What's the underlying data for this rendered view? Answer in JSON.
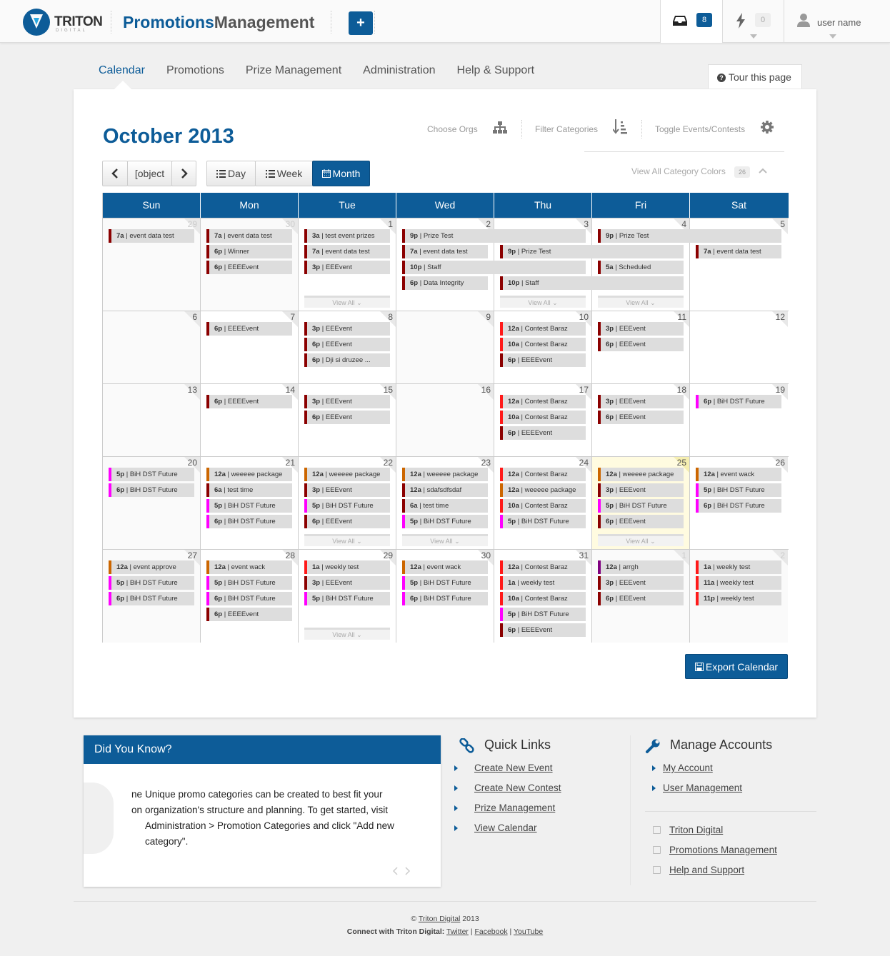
{
  "header": {
    "logo_text": "TRITON",
    "logo_sub": "DIGITAL",
    "app_title_a": "Promotions",
    "app_title_b": "Management",
    "add_label": "+",
    "inbox_count": "8",
    "alerts_count": "0",
    "user_name": "user name"
  },
  "nav": {
    "items": [
      "Calendar",
      "Promotions",
      "Prize Management",
      "Administration",
      "Help & Support"
    ],
    "active": "Calendar",
    "tour": "Tour this page"
  },
  "calendar": {
    "title": "October 2013",
    "choose_orgs": "Choose Orgs",
    "filter_categories": "Filter Categories",
    "toggle": "Toggle Events/Contests",
    "today": {
      "w": 3,
      "d": 5
    },
    "day": "Day",
    "week": "Week",
    "month": "Month",
    "view_all_colors": "View All Category Colors",
    "colors_count": "26",
    "view_all": "View All",
    "days": [
      "Sun",
      "Mon",
      "Tue",
      "Wed",
      "Thu",
      "Fri",
      "Sat"
    ],
    "weeks": [
      {
        "dates": [
          "29",
          "30",
          "1",
          "2",
          "3",
          "4",
          "5"
        ],
        "other": [
          true,
          true,
          false,
          false,
          false,
          false,
          false
        ]
      },
      {
        "dates": [
          "6",
          "7",
          "8",
          "9",
          "10",
          "11",
          "12"
        ],
        "other": [
          false,
          false,
          false,
          false,
          false,
          false,
          false
        ]
      },
      {
        "dates": [
          "13",
          "14",
          "15",
          "16",
          "17",
          "18",
          "19"
        ],
        "other": [
          false,
          false,
          false,
          false,
          false,
          false,
          false
        ]
      },
      {
        "dates": [
          "20",
          "21",
          "22",
          "23",
          "24",
          "25",
          "26"
        ],
        "other": [
          false,
          false,
          false,
          false,
          false,
          false,
          false
        ]
      },
      {
        "dates": [
          "27",
          "28",
          "29",
          "30",
          "31",
          "1",
          "2"
        ],
        "other": [
          false,
          false,
          false,
          false,
          false,
          true,
          true
        ]
      }
    ],
    "events": [
      {
        "w": 0,
        "d": 0,
        "s": 0,
        "span": 1,
        "t": "7a",
        "n": "event data test",
        "c": "#8b0000"
      },
      {
        "w": 0,
        "d": 1,
        "s": 0,
        "span": 1,
        "t": "7a",
        "n": "event data test",
        "c": "#8b0000"
      },
      {
        "w": 0,
        "d": 1,
        "s": 1,
        "span": 1,
        "t": "6p",
        "n": "Winner",
        "c": "#8b0000"
      },
      {
        "w": 0,
        "d": 1,
        "s": 2,
        "span": 1,
        "t": "6p",
        "n": "EEEEvent",
        "c": "#8b0000"
      },
      {
        "w": 0,
        "d": 2,
        "s": 0,
        "span": 1,
        "t": "3a",
        "n": "test event prizes",
        "c": "#8b0000"
      },
      {
        "w": 0,
        "d": 2,
        "s": 1,
        "span": 1,
        "t": "7a",
        "n": "event data test",
        "c": "#8b0000"
      },
      {
        "w": 0,
        "d": 2,
        "s": 2,
        "span": 1,
        "t": "3p",
        "n": "EEEvent",
        "c": "#8b0000"
      },
      {
        "w": 0,
        "d": 3,
        "s": 0,
        "span": 2,
        "t": "9p",
        "n": "Prize Test",
        "c": "#8b0000"
      },
      {
        "w": 0,
        "d": 3,
        "s": 1,
        "span": 1,
        "t": "7a",
        "n": "event data test",
        "c": "#8b0000"
      },
      {
        "w": 0,
        "d": 3,
        "s": 2,
        "span": 2,
        "t": "10p",
        "n": "Staff",
        "c": "#8b0000"
      },
      {
        "w": 0,
        "d": 3,
        "s": 3,
        "span": 1,
        "t": "6p",
        "n": "Data Integrity",
        "c": "#8b0000"
      },
      {
        "w": 0,
        "d": 4,
        "s": 1,
        "span": 2,
        "t": "9p",
        "n": "Prize Test",
        "c": "#8b0000"
      },
      {
        "w": 0,
        "d": 4,
        "s": 3,
        "span": 2,
        "t": "10p",
        "n": "Staff",
        "c": "#8b0000"
      },
      {
        "w": 0,
        "d": 5,
        "s": 0,
        "span": 2,
        "t": "9p",
        "n": "Prize Test",
        "c": "#8b0000"
      },
      {
        "w": 0,
        "d": 5,
        "s": 2,
        "span": 1,
        "t": "5a",
        "n": "Scheduled",
        "c": "#8b0000"
      },
      {
        "w": 0,
        "d": 6,
        "s": 1,
        "span": 1,
        "t": "7a",
        "n": "event data test",
        "c": "#8b0000"
      },
      {
        "w": 1,
        "d": 1,
        "s": 0,
        "span": 1,
        "t": "6p",
        "n": "EEEEvent",
        "c": "#8b0000"
      },
      {
        "w": 1,
        "d": 2,
        "s": 0,
        "span": 1,
        "t": "3p",
        "n": "EEEvent",
        "c": "#8b0000"
      },
      {
        "w": 1,
        "d": 2,
        "s": 1,
        "span": 1,
        "t": "6p",
        "n": "EEEvent",
        "c": "#8b0000"
      },
      {
        "w": 1,
        "d": 2,
        "s": 2,
        "span": 1,
        "t": "6p",
        "n": "Dji si druzee ...",
        "c": "#8b0000"
      },
      {
        "w": 1,
        "d": 4,
        "s": 0,
        "span": 1,
        "t": "12a",
        "n": "Contest Baraz",
        "c": "#ff1a1a"
      },
      {
        "w": 1,
        "d": 4,
        "s": 1,
        "span": 1,
        "t": "10a",
        "n": "Contest Baraz",
        "c": "#ff1a1a"
      },
      {
        "w": 1,
        "d": 4,
        "s": 2,
        "span": 1,
        "t": "6p",
        "n": "EEEEvent",
        "c": "#8b0000"
      },
      {
        "w": 1,
        "d": 5,
        "s": 0,
        "span": 1,
        "t": "3p",
        "n": "EEEvent",
        "c": "#8b0000"
      },
      {
        "w": 1,
        "d": 5,
        "s": 1,
        "span": 1,
        "t": "6p",
        "n": "EEEvent",
        "c": "#8b0000"
      },
      {
        "w": 2,
        "d": 1,
        "s": 0,
        "span": 1,
        "t": "6p",
        "n": "EEEEvent",
        "c": "#8b0000"
      },
      {
        "w": 2,
        "d": 2,
        "s": 0,
        "span": 1,
        "t": "3p",
        "n": "EEEvent",
        "c": "#8b0000"
      },
      {
        "w": 2,
        "d": 2,
        "s": 1,
        "span": 1,
        "t": "6p",
        "n": "EEEvent",
        "c": "#8b0000"
      },
      {
        "w": 2,
        "d": 4,
        "s": 0,
        "span": 1,
        "t": "12a",
        "n": "Contest Baraz",
        "c": "#ff1a1a"
      },
      {
        "w": 2,
        "d": 4,
        "s": 1,
        "span": 1,
        "t": "10a",
        "n": "Contest Baraz",
        "c": "#ff1a1a"
      },
      {
        "w": 2,
        "d": 4,
        "s": 2,
        "span": 1,
        "t": "6p",
        "n": "EEEEvent",
        "c": "#8b0000"
      },
      {
        "w": 2,
        "d": 5,
        "s": 0,
        "span": 1,
        "t": "3p",
        "n": "EEEvent",
        "c": "#8b0000"
      },
      {
        "w": 2,
        "d": 5,
        "s": 1,
        "span": 1,
        "t": "6p",
        "n": "EEEvent",
        "c": "#8b0000"
      },
      {
        "w": 2,
        "d": 6,
        "s": 0,
        "span": 1,
        "t": "6p",
        "n": "BiH DST Future",
        "c": "#ff00ff"
      },
      {
        "w": 3,
        "d": 0,
        "s": 0,
        "span": 1,
        "t": "5p",
        "n": "BiH DST Future",
        "c": "#ff00ff"
      },
      {
        "w": 3,
        "d": 0,
        "s": 1,
        "span": 1,
        "t": "6p",
        "n": "BiH DST Future",
        "c": "#ff00ff"
      },
      {
        "w": 3,
        "d": 1,
        "s": 0,
        "span": 1,
        "t": "12a",
        "n": "weeeee package",
        "c": "#cc6600"
      },
      {
        "w": 3,
        "d": 1,
        "s": 1,
        "span": 1,
        "t": "6a",
        "n": "test time",
        "c": "#8b0000"
      },
      {
        "w": 3,
        "d": 1,
        "s": 2,
        "span": 1,
        "t": "5p",
        "n": "BiH DST Future",
        "c": "#ff00ff"
      },
      {
        "w": 3,
        "d": 1,
        "s": 3,
        "span": 1,
        "t": "6p",
        "n": "BiH DST Future",
        "c": "#ff00ff"
      },
      {
        "w": 3,
        "d": 2,
        "s": 0,
        "span": 1,
        "t": "12a",
        "n": "weeeee package",
        "c": "#cc6600"
      },
      {
        "w": 3,
        "d": 2,
        "s": 1,
        "span": 1,
        "t": "3p",
        "n": "EEEvent",
        "c": "#8b0000"
      },
      {
        "w": 3,
        "d": 2,
        "s": 2,
        "span": 1,
        "t": "5p",
        "n": "BiH DST Future",
        "c": "#ff00ff"
      },
      {
        "w": 3,
        "d": 2,
        "s": 3,
        "span": 1,
        "t": "6p",
        "n": "EEEvent",
        "c": "#8b0000"
      },
      {
        "w": 3,
        "d": 3,
        "s": 0,
        "span": 1,
        "t": "12a",
        "n": "weeeee package",
        "c": "#cc6600"
      },
      {
        "w": 3,
        "d": 3,
        "s": 1,
        "span": 1,
        "t": "12a",
        "n": "sdafsdfsdaf",
        "c": "#8b0000"
      },
      {
        "w": 3,
        "d": 3,
        "s": 2,
        "span": 1,
        "t": "6a",
        "n": "test time",
        "c": "#8b0000"
      },
      {
        "w": 3,
        "d": 3,
        "s": 3,
        "span": 1,
        "t": "5p",
        "n": "BiH DST Future",
        "c": "#ff00ff"
      },
      {
        "w": 3,
        "d": 4,
        "s": 0,
        "span": 1,
        "t": "12a",
        "n": "Contest Baraz",
        "c": "#ff1a1a"
      },
      {
        "w": 3,
        "d": 4,
        "s": 1,
        "span": 1,
        "t": "12a",
        "n": "weeeee package",
        "c": "#cc6600"
      },
      {
        "w": 3,
        "d": 4,
        "s": 2,
        "span": 1,
        "t": "10a",
        "n": "Contest Baraz",
        "c": "#ff1a1a"
      },
      {
        "w": 3,
        "d": 4,
        "s": 3,
        "span": 1,
        "t": "5p",
        "n": "BiH DST Future",
        "c": "#ff00ff"
      },
      {
        "w": 3,
        "d": 5,
        "s": 0,
        "span": 1,
        "t": "12a",
        "n": "weeeee package",
        "c": "#cc6600"
      },
      {
        "w": 3,
        "d": 5,
        "s": 1,
        "span": 1,
        "t": "3p",
        "n": "EEEvent",
        "c": "#8b0000"
      },
      {
        "w": 3,
        "d": 5,
        "s": 2,
        "span": 1,
        "t": "5p",
        "n": "BiH DST Future",
        "c": "#ff00ff"
      },
      {
        "w": 3,
        "d": 5,
        "s": 3,
        "span": 1,
        "t": "6p",
        "n": "EEEvent",
        "c": "#8b0000"
      },
      {
        "w": 3,
        "d": 6,
        "s": 0,
        "span": 1,
        "t": "12a",
        "n": "event wack",
        "c": "#cc6600"
      },
      {
        "w": 3,
        "d": 6,
        "s": 1,
        "span": 1,
        "t": "5p",
        "n": "BiH DST Future",
        "c": "#ff00ff"
      },
      {
        "w": 3,
        "d": 6,
        "s": 2,
        "span": 1,
        "t": "6p",
        "n": "BiH DST Future",
        "c": "#ff00ff"
      },
      {
        "w": 4,
        "d": 0,
        "s": 0,
        "span": 1,
        "t": "12a",
        "n": "event approve",
        "c": "#cc6600"
      },
      {
        "w": 4,
        "d": 0,
        "s": 1,
        "span": 1,
        "t": "5p",
        "n": "BiH DST Future",
        "c": "#ff00ff"
      },
      {
        "w": 4,
        "d": 0,
        "s": 2,
        "span": 1,
        "t": "6p",
        "n": "BiH DST Future",
        "c": "#ff00ff"
      },
      {
        "w": 4,
        "d": 1,
        "s": 0,
        "span": 1,
        "t": "12a",
        "n": "event wack",
        "c": "#cc6600"
      },
      {
        "w": 4,
        "d": 1,
        "s": 1,
        "span": 1,
        "t": "5p",
        "n": "BiH DST Future",
        "c": "#ff00ff"
      },
      {
        "w": 4,
        "d": 1,
        "s": 2,
        "span": 1,
        "t": "6p",
        "n": "BiH DST Future",
        "c": "#ff00ff"
      },
      {
        "w": 4,
        "d": 1,
        "s": 3,
        "span": 1,
        "t": "6p",
        "n": "EEEEvent",
        "c": "#8b0000"
      },
      {
        "w": 4,
        "d": 2,
        "s": 0,
        "span": 1,
        "t": "1a",
        "n": "weekly test",
        "c": "#ff1a1a"
      },
      {
        "w": 4,
        "d": 2,
        "s": 1,
        "span": 1,
        "t": "3p",
        "n": "EEEvent",
        "c": "#8b0000"
      },
      {
        "w": 4,
        "d": 2,
        "s": 2,
        "span": 1,
        "t": "5p",
        "n": "BiH DST Future",
        "c": "#ff00ff"
      },
      {
        "w": 4,
        "d": 3,
        "s": 0,
        "span": 1,
        "t": "12a",
        "n": "event wack",
        "c": "#cc6600"
      },
      {
        "w": 4,
        "d": 3,
        "s": 1,
        "span": 1,
        "t": "5p",
        "n": "BiH DST Future",
        "c": "#ff00ff"
      },
      {
        "w": 4,
        "d": 3,
        "s": 2,
        "span": 1,
        "t": "6p",
        "n": "BiH DST Future",
        "c": "#ff00ff"
      },
      {
        "w": 4,
        "d": 4,
        "s": 0,
        "span": 1,
        "t": "12a",
        "n": "Contest Baraz",
        "c": "#ff1a1a"
      },
      {
        "w": 4,
        "d": 4,
        "s": 1,
        "span": 1,
        "t": "1a",
        "n": "weekly test",
        "c": "#ff1a1a"
      },
      {
        "w": 4,
        "d": 4,
        "s": 2,
        "span": 1,
        "t": "10a",
        "n": "Contest Baraz",
        "c": "#ff1a1a"
      },
      {
        "w": 4,
        "d": 4,
        "s": 3,
        "span": 1,
        "t": "5p",
        "n": "BiH DST Future",
        "c": "#ff00ff"
      },
      {
        "w": 4,
        "d": 4,
        "s": 4,
        "span": 1,
        "t": "6p",
        "n": "EEEEvent",
        "c": "#8b0000"
      },
      {
        "w": 4,
        "d": 5,
        "s": 0,
        "span": 1,
        "t": "12a",
        "n": "arrgh",
        "c": "#800080"
      },
      {
        "w": 4,
        "d": 5,
        "s": 1,
        "span": 1,
        "t": "3p",
        "n": "EEEvent",
        "c": "#8b0000"
      },
      {
        "w": 4,
        "d": 5,
        "s": 2,
        "span": 1,
        "t": "6p",
        "n": "EEEvent",
        "c": "#8b0000"
      },
      {
        "w": 4,
        "d": 6,
        "s": 0,
        "span": 1,
        "t": "1a",
        "n": "weekly test",
        "c": "#ff1a1a"
      },
      {
        "w": 4,
        "d": 6,
        "s": 1,
        "span": 1,
        "t": "11a",
        "n": "weekly test",
        "c": "#ff1a1a"
      },
      {
        "w": 4,
        "d": 6,
        "s": 2,
        "span": 1,
        "t": "11p",
        "n": "weekly test",
        "c": "#ff1a1a"
      }
    ],
    "view_all_links": [
      {
        "w": 0,
        "d": 2
      },
      {
        "w": 0,
        "d": 4
      },
      {
        "w": 0,
        "d": 5
      },
      {
        "w": 3,
        "d": 2
      },
      {
        "w": 3,
        "d": 3
      },
      {
        "w": 3,
        "d": 5
      },
      {
        "w": 4,
        "d": 2
      }
    ],
    "export": "Export Calendar"
  },
  "did_you_know": {
    "title": "Did You Know?",
    "cut_text": "ne on",
    "text": "Unique promo categories can be created to best fit your organization's structure and planning. To get started, visit Administration > Promotion Categories and click \"Add new category\"."
  },
  "quick_links": {
    "title": "Quick Links",
    "items": [
      "Create New Event",
      "Create New Contest",
      "Prize Management",
      "View Calendar"
    ]
  },
  "manage_accounts": {
    "title": "Manage Accounts",
    "items": [
      "My Account",
      "User Management"
    ],
    "external": [
      "Triton Digital",
      "Promotions Management",
      "Help and Support"
    ]
  },
  "footer": {
    "copyright_symbol": "©",
    "company": "Triton Digital",
    "year": "2013",
    "connect": "Connect with Triton Digital:",
    "links": [
      "Twitter",
      "Facebook",
      "YouTube"
    ]
  }
}
